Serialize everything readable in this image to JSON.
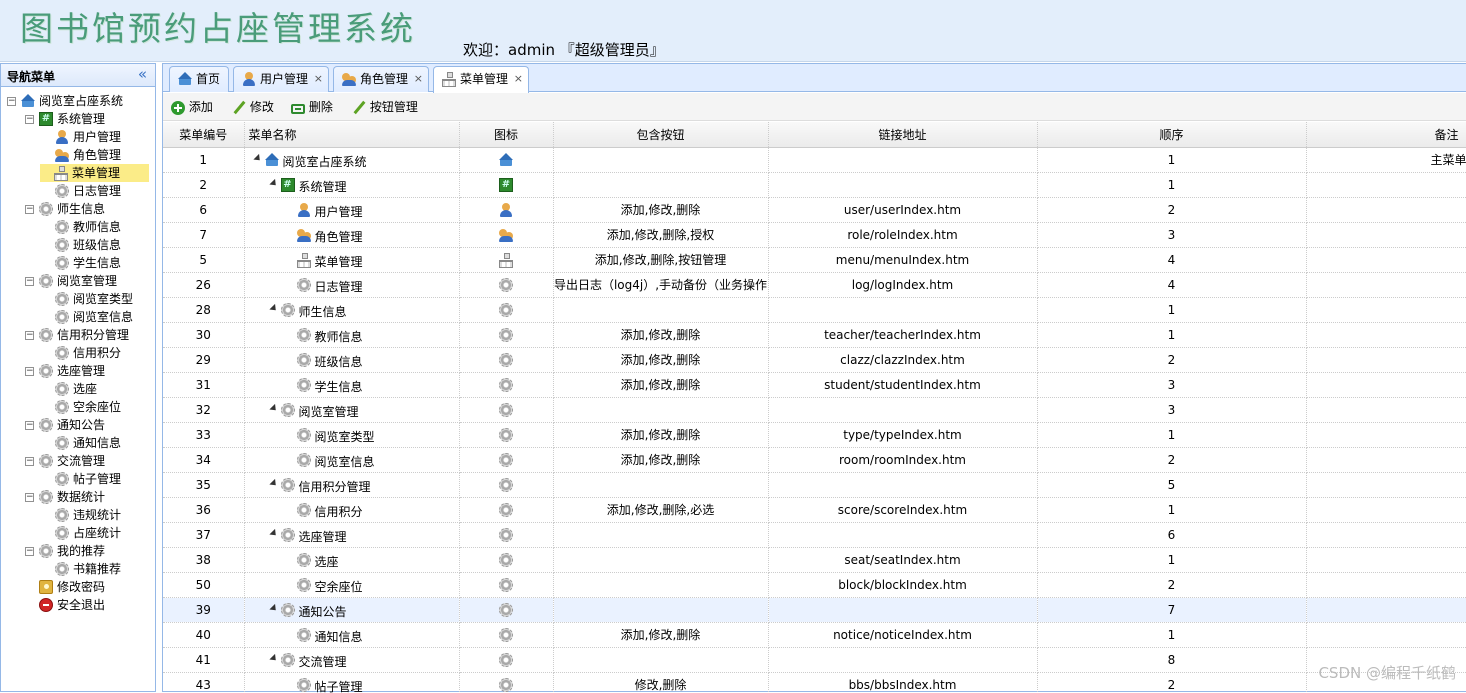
{
  "header": {
    "title": "图书馆预约占座管理系统",
    "welcome": "欢迎：admin 『超级管理员』"
  },
  "sidebar": {
    "title": "导航菜单",
    "collapse_icon": "«",
    "items": [
      {
        "label": "阅览室占座系统",
        "icon": "home-icon",
        "level": 0
      },
      {
        "label": "系统管理",
        "icon": "grid-icon",
        "level": 1
      },
      {
        "label": "用户管理",
        "icon": "user-icon",
        "level": 2
      },
      {
        "label": "角色管理",
        "icon": "role-icon",
        "level": 2
      },
      {
        "label": "菜单管理",
        "icon": "menu-icon",
        "level": 2,
        "selected": true
      },
      {
        "label": "日志管理",
        "icon": "gear-icon",
        "level": 2
      },
      {
        "label": "师生信息",
        "icon": "gear-icon",
        "level": 1
      },
      {
        "label": "教师信息",
        "icon": "gear-icon",
        "level": 2
      },
      {
        "label": "班级信息",
        "icon": "gear-icon",
        "level": 2
      },
      {
        "label": "学生信息",
        "icon": "gear-icon",
        "level": 2
      },
      {
        "label": "阅览室管理",
        "icon": "gear-icon",
        "level": 1
      },
      {
        "label": "阅览室类型",
        "icon": "gear-icon",
        "level": 2
      },
      {
        "label": "阅览室信息",
        "icon": "gear-icon",
        "level": 2
      },
      {
        "label": "信用积分管理",
        "icon": "gear-icon",
        "level": 1
      },
      {
        "label": "信用积分",
        "icon": "gear-icon",
        "level": 2
      },
      {
        "label": "选座管理",
        "icon": "gear-icon",
        "level": 1
      },
      {
        "label": "选座",
        "icon": "gear-icon",
        "level": 2
      },
      {
        "label": "空余座位",
        "icon": "gear-icon",
        "level": 2
      },
      {
        "label": "通知公告",
        "icon": "gear-icon",
        "level": 1
      },
      {
        "label": "通知信息",
        "icon": "gear-icon",
        "level": 2
      },
      {
        "label": "交流管理",
        "icon": "gear-icon",
        "level": 1
      },
      {
        "label": "帖子管理",
        "icon": "gear-icon",
        "level": 2
      },
      {
        "label": "数据统计",
        "icon": "gear-icon",
        "level": 1
      },
      {
        "label": "违规统计",
        "icon": "gear-icon",
        "level": 2
      },
      {
        "label": "占座统计",
        "icon": "gear-icon",
        "level": 2
      },
      {
        "label": "我的推荐",
        "icon": "gear-icon",
        "level": 1
      },
      {
        "label": "书籍推荐",
        "icon": "gear-icon",
        "level": 2
      },
      {
        "label": "修改密码",
        "icon": "password-icon",
        "level": 1
      },
      {
        "label": "安全退出",
        "icon": "exit-icon",
        "level": 1
      }
    ]
  },
  "tabs": [
    {
      "label": "首页",
      "icon": "home-icon",
      "closable": false
    },
    {
      "label": "用户管理",
      "icon": "user-icon",
      "closable": true
    },
    {
      "label": "角色管理",
      "icon": "role-icon",
      "closable": true
    },
    {
      "label": "菜单管理",
      "icon": "menu-icon",
      "closable": true,
      "active": true
    }
  ],
  "toolbar": {
    "add_label": "添加",
    "edit_label": "修改",
    "delete_label": "删除",
    "buttons_label": "按钮管理"
  },
  "grid": {
    "columns": [
      "菜单编号",
      "菜单名称",
      "图标",
      "包含按钮",
      "链接地址",
      "顺序",
      "备注"
    ],
    "rows": [
      {
        "id": "1",
        "name": "阅览室占座系统",
        "icon": "home-icon",
        "level": 0,
        "arrow": true,
        "buttons": "",
        "url": "",
        "order": "1",
        "remark": "主菜单"
      },
      {
        "id": "2",
        "name": "系统管理",
        "icon": "grid-icon",
        "level": 1,
        "arrow": true,
        "buttons": "",
        "url": "",
        "order": "1",
        "remark": ""
      },
      {
        "id": "6",
        "name": "用户管理",
        "icon": "user-icon",
        "level": 2,
        "arrow": false,
        "buttons": "添加,修改,删除",
        "url": "user/userIndex.htm",
        "order": "2",
        "remark": ""
      },
      {
        "id": "7",
        "name": "角色管理",
        "icon": "role-icon",
        "level": 2,
        "arrow": false,
        "buttons": "添加,修改,删除,授权",
        "url": "role/roleIndex.htm",
        "order": "3",
        "remark": ""
      },
      {
        "id": "5",
        "name": "菜单管理",
        "icon": "menu-icon",
        "level": 2,
        "arrow": false,
        "buttons": "添加,修改,删除,按钮管理",
        "url": "menu/menuIndex.htm",
        "order": "4",
        "remark": ""
      },
      {
        "id": "26",
        "name": "日志管理",
        "icon": "gear-icon",
        "level": 2,
        "arrow": false,
        "buttons": "导出日志（log4j）,手动备份（业务操作",
        "url": "log/logIndex.htm",
        "order": "4",
        "remark": ""
      },
      {
        "id": "28",
        "name": "师生信息",
        "icon": "gear-icon",
        "level": 1,
        "arrow": true,
        "buttons": "",
        "url": "",
        "order": "1",
        "remark": ""
      },
      {
        "id": "30",
        "name": "教师信息",
        "icon": "gear-icon",
        "level": 2,
        "arrow": false,
        "buttons": "添加,修改,删除",
        "url": "teacher/teacherIndex.htm",
        "order": "1",
        "remark": ""
      },
      {
        "id": "29",
        "name": "班级信息",
        "icon": "gear-icon",
        "level": 2,
        "arrow": false,
        "buttons": "添加,修改,删除",
        "url": "clazz/clazzIndex.htm",
        "order": "2",
        "remark": ""
      },
      {
        "id": "31",
        "name": "学生信息",
        "icon": "gear-icon",
        "level": 2,
        "arrow": false,
        "buttons": "添加,修改,删除",
        "url": "student/studentIndex.htm",
        "order": "3",
        "remark": ""
      },
      {
        "id": "32",
        "name": "阅览室管理",
        "icon": "gear-icon",
        "level": 1,
        "arrow": true,
        "buttons": "",
        "url": "",
        "order": "3",
        "remark": ""
      },
      {
        "id": "33",
        "name": "阅览室类型",
        "icon": "gear-icon",
        "level": 2,
        "arrow": false,
        "buttons": "添加,修改,删除",
        "url": "type/typeIndex.htm",
        "order": "1",
        "remark": ""
      },
      {
        "id": "34",
        "name": "阅览室信息",
        "icon": "gear-icon",
        "level": 2,
        "arrow": false,
        "buttons": "添加,修改,删除",
        "url": "room/roomIndex.htm",
        "order": "2",
        "remark": ""
      },
      {
        "id": "35",
        "name": "信用积分管理",
        "icon": "gear-icon",
        "level": 1,
        "arrow": true,
        "buttons": "",
        "url": "",
        "order": "5",
        "remark": ""
      },
      {
        "id": "36",
        "name": "信用积分",
        "icon": "gear-icon",
        "level": 2,
        "arrow": false,
        "buttons": "添加,修改,删除,必选",
        "url": "score/scoreIndex.htm",
        "order": "1",
        "remark": ""
      },
      {
        "id": "37",
        "name": "选座管理",
        "icon": "gear-icon",
        "level": 1,
        "arrow": true,
        "buttons": "",
        "url": "",
        "order": "6",
        "remark": ""
      },
      {
        "id": "38",
        "name": "选座",
        "icon": "gear-icon",
        "level": 2,
        "arrow": false,
        "buttons": "",
        "url": "seat/seatIndex.htm",
        "order": "1",
        "remark": ""
      },
      {
        "id": "50",
        "name": "空余座位",
        "icon": "gear-icon",
        "level": 2,
        "arrow": false,
        "buttons": "",
        "url": "block/blockIndex.htm",
        "order": "2",
        "remark": ""
      },
      {
        "id": "39",
        "name": "通知公告",
        "icon": "gear-icon",
        "level": 1,
        "arrow": true,
        "buttons": "",
        "url": "",
        "order": "7",
        "remark": "",
        "highlight": true
      },
      {
        "id": "40",
        "name": "通知信息",
        "icon": "gear-icon",
        "level": 2,
        "arrow": false,
        "buttons": "添加,修改,删除",
        "url": "notice/noticeIndex.htm",
        "order": "1",
        "remark": ""
      },
      {
        "id": "41",
        "name": "交流管理",
        "icon": "gear-icon",
        "level": 1,
        "arrow": true,
        "buttons": "",
        "url": "",
        "order": "8",
        "remark": ""
      },
      {
        "id": "43",
        "name": "帖子管理",
        "icon": "gear-icon",
        "level": 2,
        "arrow": false,
        "buttons": "修改,删除",
        "url": "bbs/bbsIndex.htm",
        "order": "2",
        "remark": ""
      }
    ]
  },
  "watermark": "CSDN @编程千纸鹤"
}
